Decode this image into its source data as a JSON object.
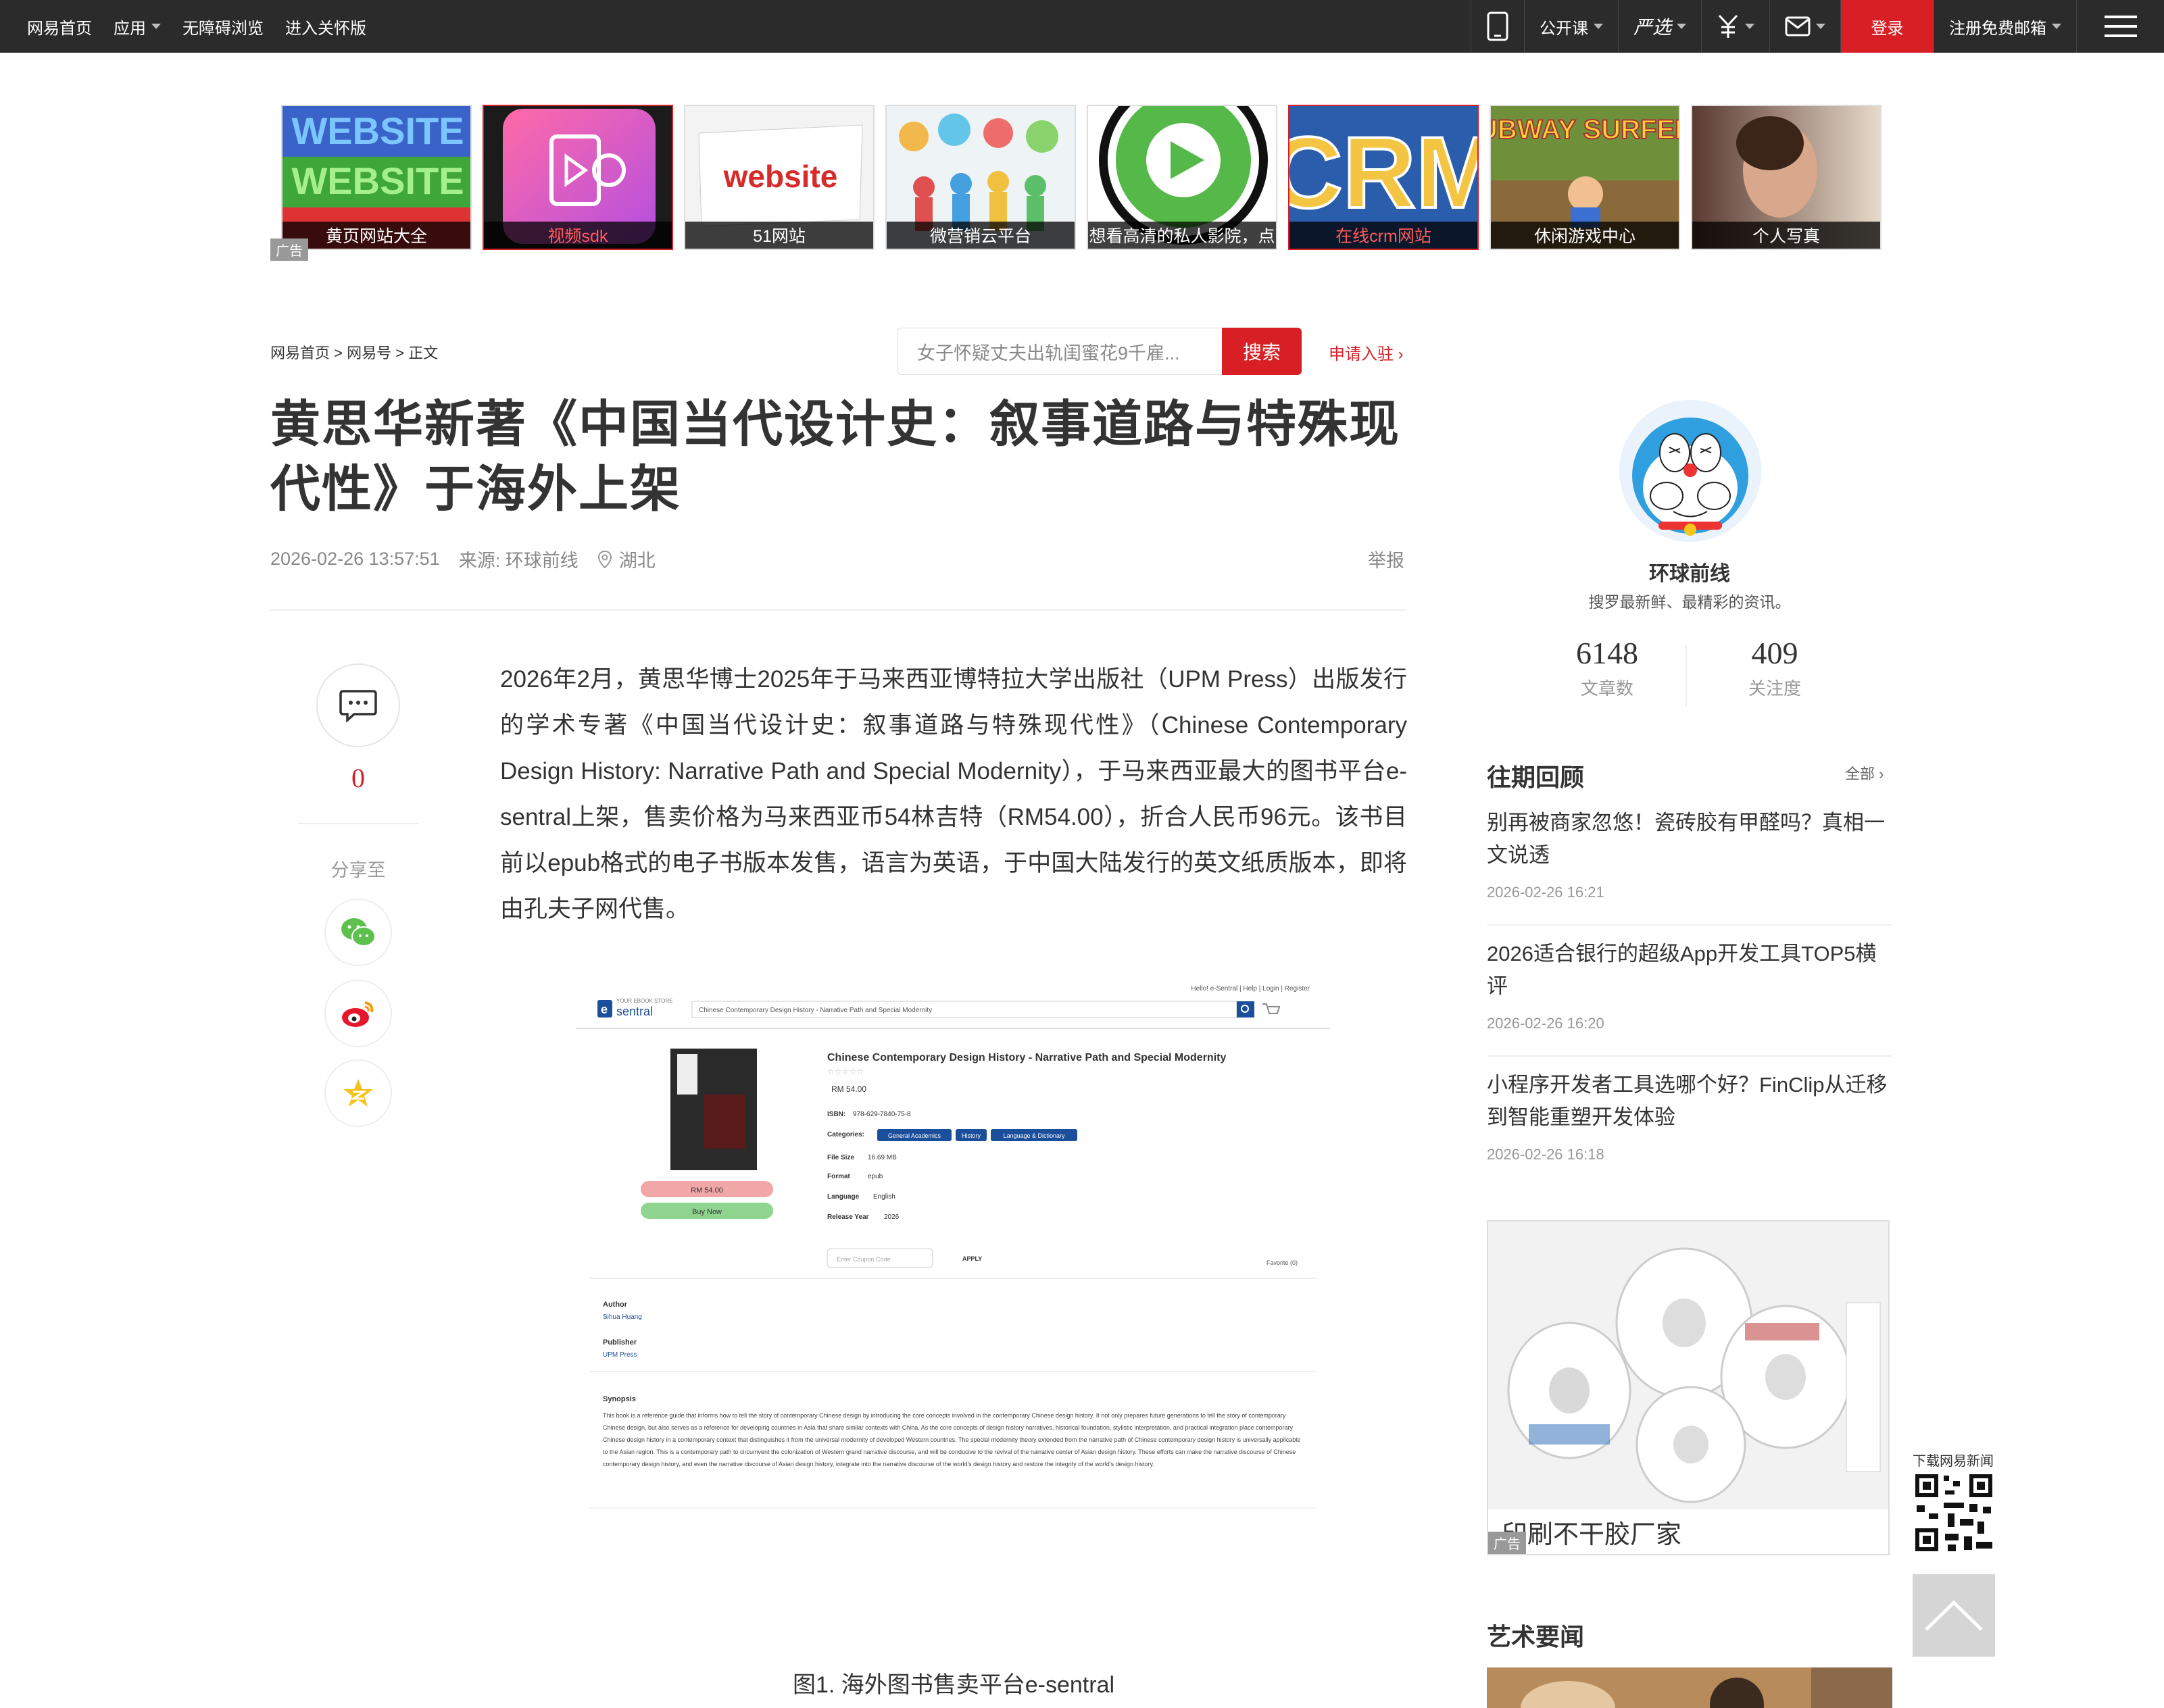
{
  "topbar": {
    "home": "网易首页",
    "apps": "应用",
    "accessible": "无障碍浏览",
    "care": "进入关怀版",
    "open_course": "公开课",
    "yanxuan": "严选",
    "login": "登录",
    "register": "注册免费邮箱"
  },
  "ads": {
    "badge": "广告",
    "tiles": [
      {
        "caption": "黄页网站大全",
        "art": "WEBSITE"
      },
      {
        "caption": "视频sdk"
      },
      {
        "caption": "51网站",
        "art": "website"
      },
      {
        "caption": "微营销云平台"
      },
      {
        "caption": "想看高清的私人影院，点"
      },
      {
        "caption": "在线crm网站",
        "art": "CRM"
      },
      {
        "caption": "休闲游戏中心",
        "art": "SUBWAY SURFERS"
      },
      {
        "caption": "个人写真"
      }
    ]
  },
  "breadcrumb": {
    "home": "网易首页",
    "sep": ">",
    "hao": "网易号",
    "current": "正文"
  },
  "search": {
    "placeholder": "女子怀疑丈夫出轨闺蜜花9千雇...",
    "button": "搜索"
  },
  "apply": "申请入驻",
  "article": {
    "title": "黄思华新著《中国当代设计史：叙事道路与特殊现代性》于海外上架",
    "datetime": "2026-02-26 13:57:51",
    "source": "来源: 环球前线",
    "location": "湖北",
    "report": "举报",
    "body": "2026年2月，黄思华博士2025年于马来西亚博特拉大学出版社（UPM Press）出版发行的学术专著《中国当代设计史：叙事道路与特殊现代性》（Chinese Contemporary Design History: Narrative Path and Special Modernity），于马来西亚最大的图书平台e-sentral上架，售卖价格为马来西亚币54林吉特（RM54.00），折合人民币96元。该书目前以epub格式的电子书版本发售，语言为英语，于中国大陆发行的英文纸质版本，即将由孔夫子网代售。",
    "figure_caption": "图1. 海外图书售卖平台e-sentral"
  },
  "share": {
    "comment_count": "0",
    "label": "分享至"
  },
  "figure": {
    "logo_top": "YOUR EBOOK STORE",
    "logo": "sentral",
    "search_text": "Chinese Contemporary Design History - Narrative Path and Special Modernity",
    "toplinks": "Hello! e-Sentral | Help | Login | Register",
    "book_title": "Chinese Contemporary Design History - Narrative Path and Special Modernity",
    "price": "RM 54.00",
    "isbn_label": "ISBN:",
    "isbn": "978-629-7840-75-8",
    "categories_label": "Categories:",
    "categories": [
      "General Academics",
      "History",
      "Language & Dictionary"
    ],
    "filesize_label": "File Size",
    "filesize": "16.69 MB",
    "format_label": "Format",
    "format": "epub",
    "language_label": "Language",
    "language": "English",
    "release_label": "Release Year",
    "release": "2026",
    "price_btn": "RM 54.00",
    "buy_btn": "Buy Now",
    "coupon_placeholder": "Enter Coupon Code",
    "apply": "APPLY",
    "favorite": "Favorite (0)",
    "author_label": "Author",
    "author": "Sihua Huang",
    "publisher_label": "Publisher",
    "publisher": "UPM Press",
    "synopsis_label": "Synopsis",
    "synopsis": "This book is a reference guide that informs how to tell the story of contemporary Chinese design by introducing the core concepts involved in the contemporary Chinese design history. It not only prepares future generations to tell the story of contemporary Chinese design, but also serves as a reference for developing countries in Asia that share similar contexts with China. As the core concepts of design history narratives, historical foundation, stylistic interpretation, and practical integration place contemporary Chinese design history in a contemporary context that distinguishes it from the universal modernity of developed Western countries. The special modernity theory extended from the narrative path of Chinese contemporary design history is universally applicable to the Asian region. This is a contemporary path to circumvent the colonization of Western grand narrative discourse, and will be conducive to the revival of the narrative center of Asian design history. These efforts can make the narrative discourse of Chinese contemporary design history, and even the narrative discourse of Asian design history, integrate into the narrative discourse of the world's design history and restore the integrity of the world's design history."
  },
  "sidebar": {
    "author_name": "环球前线",
    "author_desc": "搜罗最新鲜、最精彩的资讯。",
    "articles_count": "6148",
    "articles_label": "文章数",
    "follow_count": "409",
    "follow_label": "关注度",
    "past_title": "往期回顾",
    "all": "全部",
    "news": [
      {
        "title": "别再被商家忽悠！瓷砖胶有甲醛吗？真相一文说透",
        "date": "2026-02-26 16:21"
      },
      {
        "title": "2026适合银行的超级App开发工具TOP5横评",
        "date": "2026-02-26 16:20"
      },
      {
        "title": "小程序开发者工具选哪个好？FinClip从迁移到智能重塑开发体验",
        "date": "2026-02-26 16:18"
      }
    ],
    "ad_caption": "印刷不干胶厂家",
    "ad_badge": "广告",
    "art_title": "艺术要闻",
    "qr_label": "下载网易新闻"
  },
  "colors": {
    "brand_red": "#d81f26",
    "topbar": "#2b2b2b"
  }
}
